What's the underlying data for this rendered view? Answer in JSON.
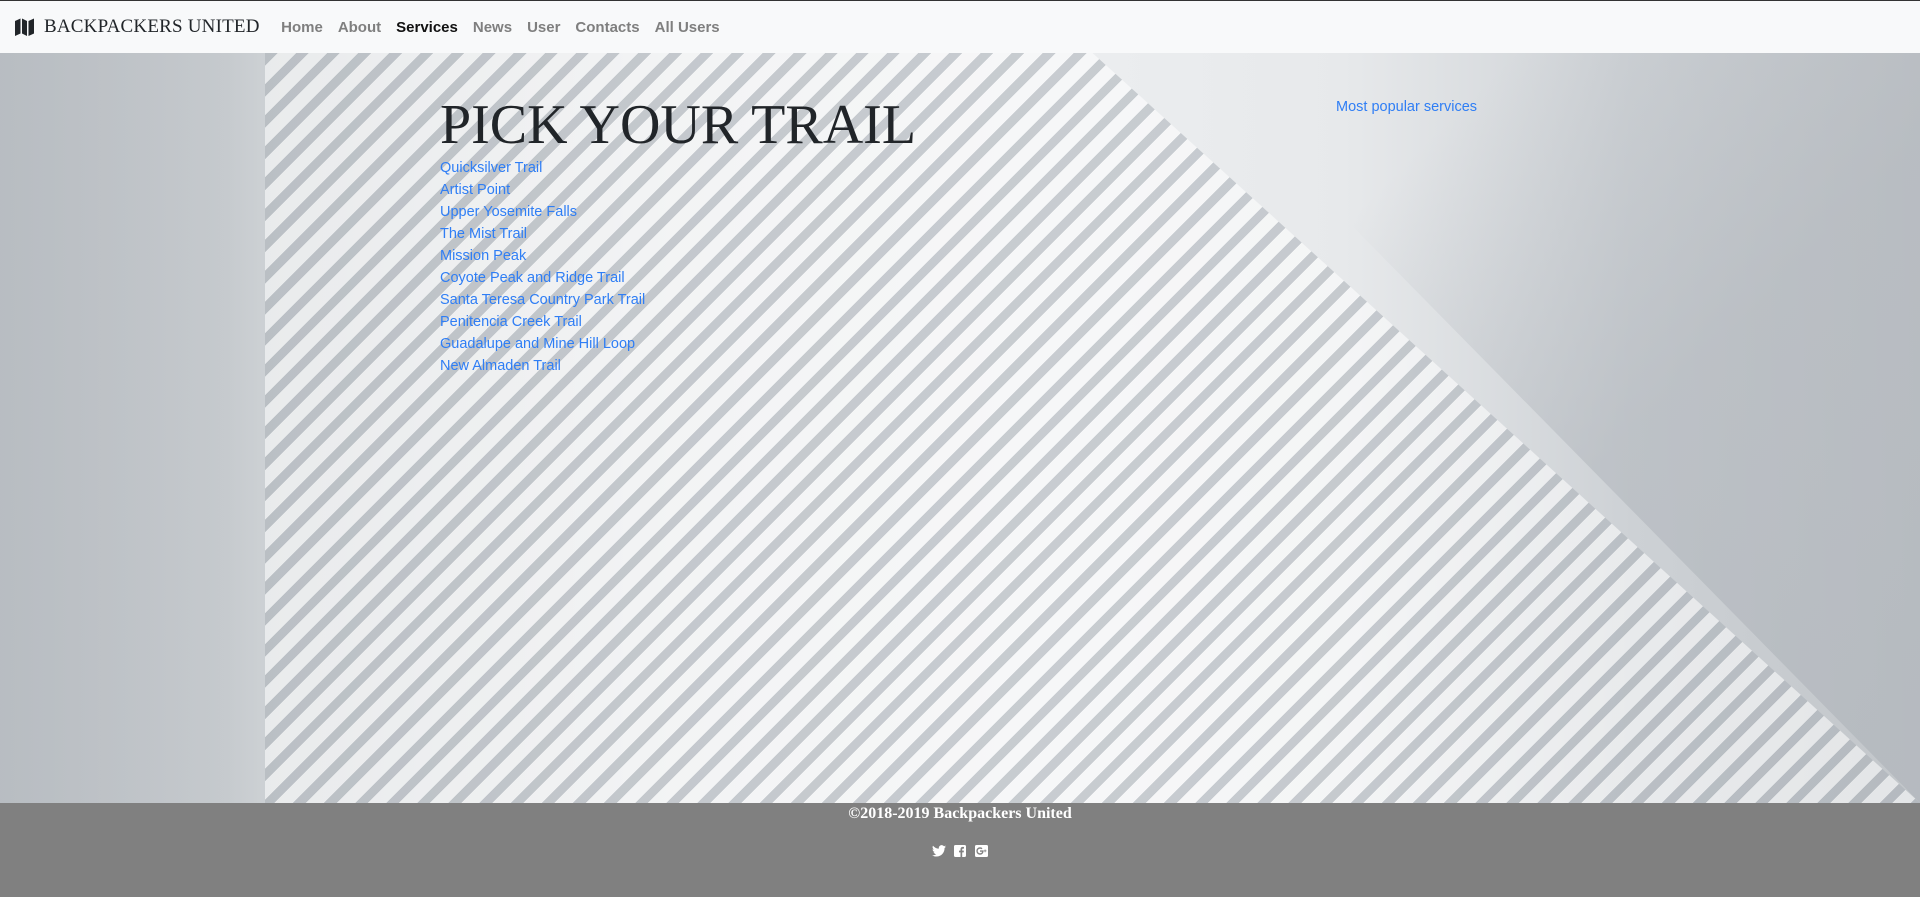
{
  "navbar": {
    "brand": "BACKPACKERS UNITED",
    "brand_icon": "map-icon",
    "items": [
      {
        "label": "Home",
        "active": false
      },
      {
        "label": "About",
        "active": false
      },
      {
        "label": "Services",
        "active": true
      },
      {
        "label": "News",
        "active": false
      },
      {
        "label": "User",
        "active": false
      },
      {
        "label": "Contacts",
        "active": false
      },
      {
        "label": "All Users",
        "active": false
      }
    ]
  },
  "main": {
    "title": "PICK YOUR TRAIL",
    "trails": [
      "Quicksilver Trail",
      "Artist Point",
      "Upper Yosemite Falls",
      "The Mist Trail",
      "Mission Peak",
      "Coyote Peak and Ridge Trail",
      "Santa Teresa Country Park Trail",
      "Penitencia Creek Trail",
      "Guadalupe and Mine Hill Loop",
      "New Almaden Trail"
    ],
    "popular_link": "Most popular services"
  },
  "footer": {
    "copyright": "©2018-2019 Backpackers United",
    "social_icons": [
      "twitter-icon",
      "facebook-icon",
      "google-plus-icon"
    ]
  },
  "colors": {
    "link": "#2f7ef5",
    "navbar_bg": "#f8f9fa",
    "footer_bg": "#808080",
    "nav_inactive": "#7f7f7f",
    "nav_active": "#111111"
  }
}
